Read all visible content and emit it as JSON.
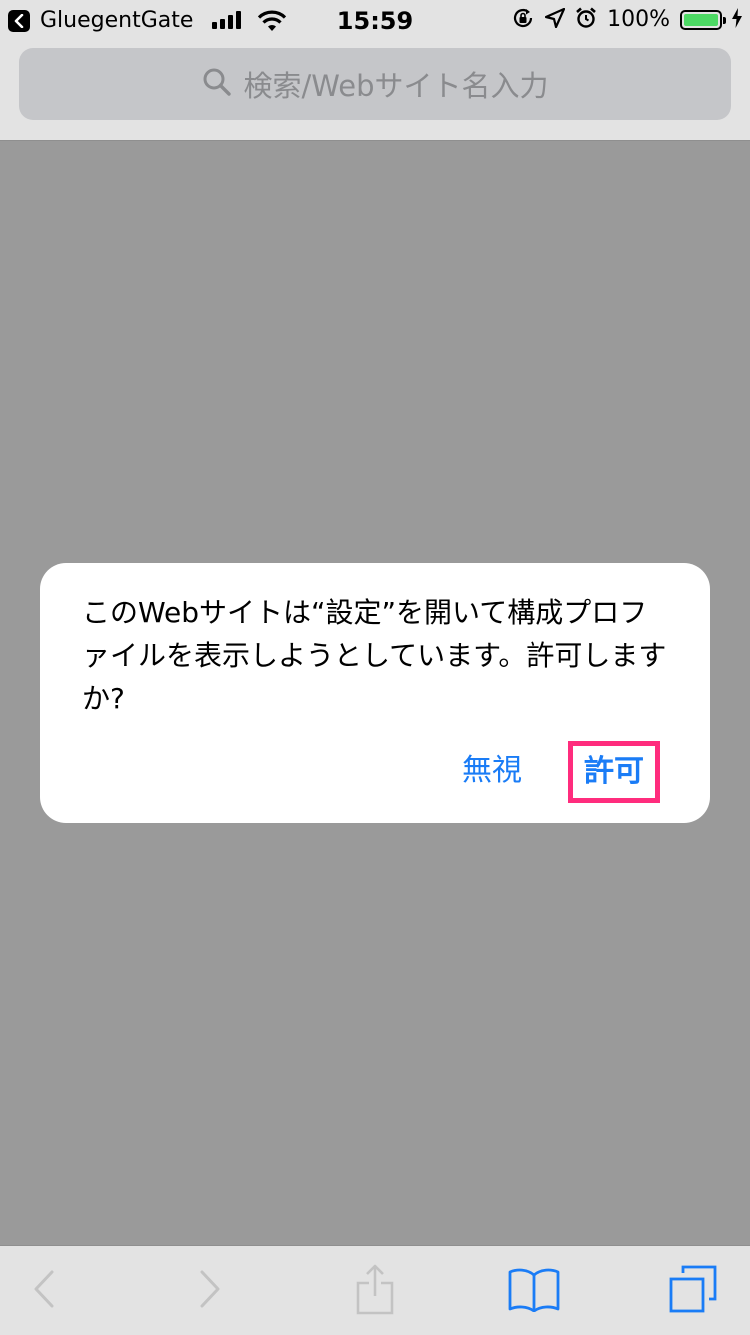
{
  "status_bar": {
    "back_app_name": "GluegentGate",
    "time": "15:59",
    "battery_percent": "100%",
    "battery_level": 1.0,
    "battery_color": "#4cd964",
    "signal_bars": 4,
    "icons": [
      "back-arrow-icon",
      "signal-icon",
      "wifi-icon",
      "rotation-lock-icon",
      "location-arrow-icon",
      "alarm-icon",
      "battery-icon",
      "charging-bolt-icon"
    ]
  },
  "search_bar": {
    "placeholder": "検索/Webサイト名入力",
    "icon": "search-icon"
  },
  "alert": {
    "message": "このWebサイトは“設定”を開いて構成プロファイルを表示しようとしています。許可しますか?",
    "ignore_label": "無視",
    "allow_label": "許可",
    "button_color": "#1a7cf6",
    "highlight_color": "#ff2c7d"
  },
  "toolbar": {
    "items": [
      "back-icon",
      "forward-icon",
      "share-icon",
      "bookmarks-icon",
      "tabs-icon"
    ]
  }
}
